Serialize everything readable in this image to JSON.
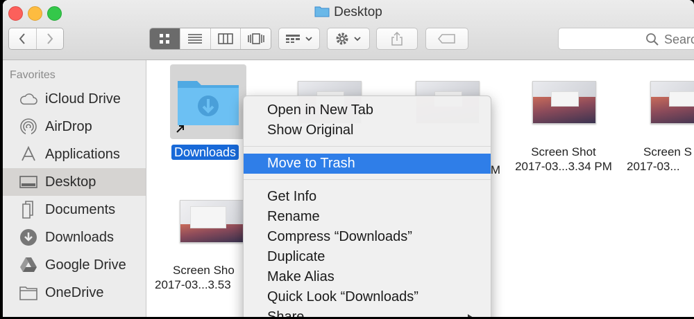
{
  "window": {
    "title": "Desktop"
  },
  "toolbar": {
    "back_icon": "chevron-left-icon",
    "forward_icon": "chevron-right-icon",
    "view_modes": [
      "icon-view-icon",
      "list-view-icon",
      "column-view-icon",
      "cover-flow-icon"
    ],
    "active_view": 0,
    "search_placeholder": "Search"
  },
  "sidebar": {
    "section_title": "Favorites",
    "items": [
      {
        "label": "iCloud Drive",
        "icon": "cloud-icon"
      },
      {
        "label": "AirDrop",
        "icon": "airdrop-icon"
      },
      {
        "label": "Applications",
        "icon": "applications-icon"
      },
      {
        "label": "Desktop",
        "icon": "desktop-icon",
        "selected": true
      },
      {
        "label": "Documents",
        "icon": "documents-icon"
      },
      {
        "label": "Downloads",
        "icon": "downloads-icon"
      },
      {
        "label": "Google Drive",
        "icon": "google-drive-icon"
      },
      {
        "label": "OneDrive",
        "icon": "folder-icon"
      }
    ]
  },
  "files": [
    {
      "name": "Downloads",
      "kind": "alias-folder",
      "selected": true
    },
    {
      "name_line1": "",
      "name_line2": "M"
    },
    {
      "name_line1": "",
      "name_line2": ""
    },
    {
      "name_line1": "Screen Shot",
      "name_line2": "2017-03...3.34 PM"
    },
    {
      "name_line1": "Screen S",
      "name_line2": "2017-03..."
    },
    {
      "name_line1": "Screen Sho",
      "name_line2": "2017-03...3.53"
    }
  ],
  "context_menu": {
    "items": [
      "Open in New Tab",
      "Show Original",
      "Move to Trash",
      "Get Info",
      "Rename",
      "Compress “Downloads”",
      "Duplicate",
      "Make Alias",
      "Quick Look “Downloads”",
      "Share"
    ],
    "highlighted_index": 2
  },
  "colors": {
    "selection_blue": "#1869d8",
    "menu_highlight": "#2f7ee8",
    "folder_blue": "#5ab4ec"
  }
}
